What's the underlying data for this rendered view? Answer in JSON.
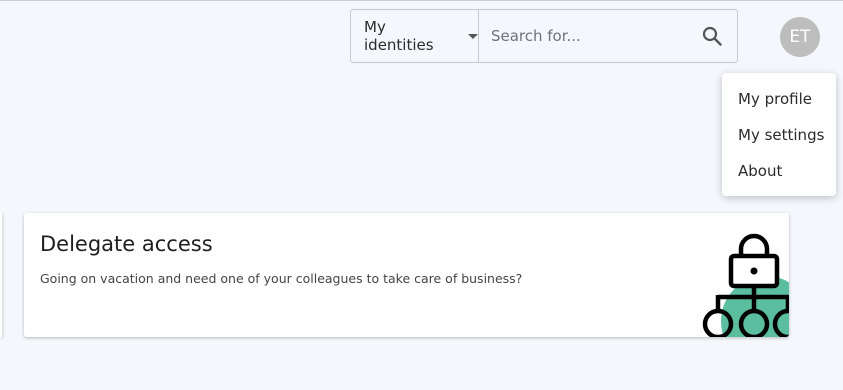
{
  "header": {
    "identity_select": {
      "label": "My identities"
    },
    "search": {
      "placeholder": "Search for..."
    },
    "avatar": {
      "initials": "ET"
    }
  },
  "user_menu": {
    "items": [
      {
        "label": "My profile"
      },
      {
        "label": "My settings"
      },
      {
        "label": "About"
      }
    ]
  },
  "card": {
    "title": "Delegate access",
    "description": "Going on vacation and need one of your colleagues to take care of business?",
    "illustration_icon": "lock-hierarchy-icon",
    "accent_color": "#5bbf9f"
  },
  "colors": {
    "background": "#f4f8fc",
    "avatar": "#bdbdbd"
  }
}
